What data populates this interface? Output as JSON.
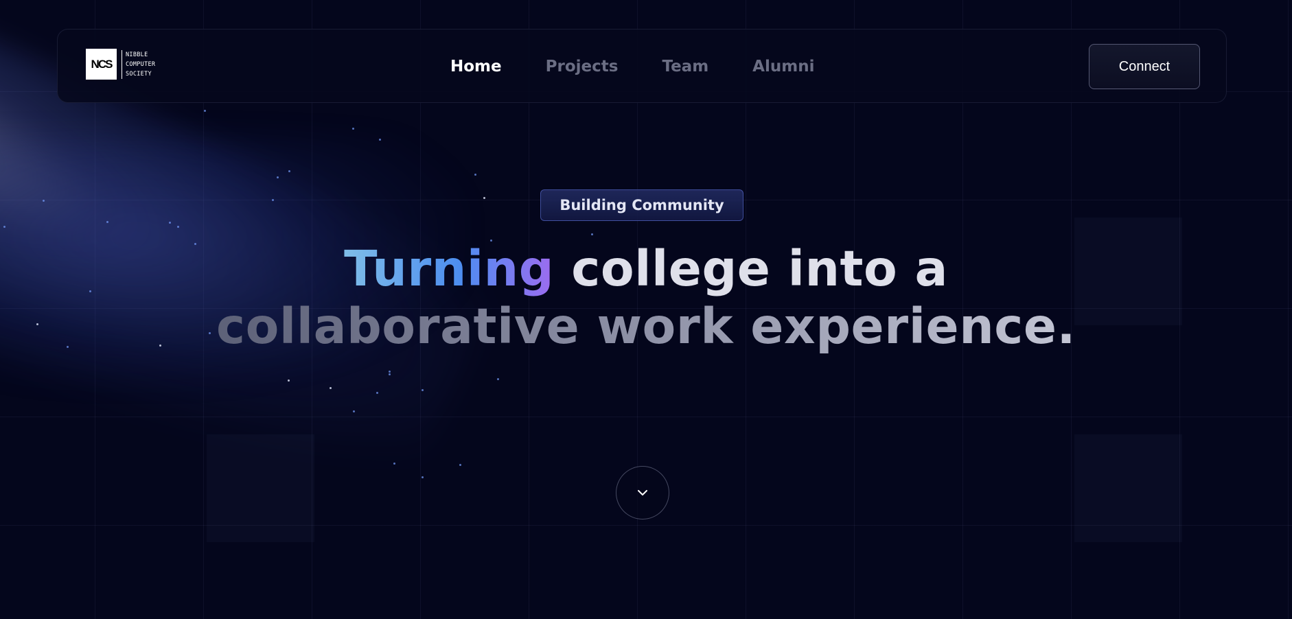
{
  "logo": {
    "mark": "NCS",
    "lines": [
      "NIBBLE",
      "COMPUTER",
      "SOCIETY"
    ]
  },
  "nav": {
    "links": [
      {
        "label": "Home",
        "active": true
      },
      {
        "label": "Projects",
        "active": false
      },
      {
        "label": "Team",
        "active": false
      },
      {
        "label": "Alumni",
        "active": false
      }
    ],
    "connect_label": "Connect"
  },
  "hero": {
    "badge": "Building Community",
    "headline_highlight": "Turning",
    "headline_line1_rest": " college into a",
    "headline_line2": "collaborative work experience."
  },
  "scroll": {
    "icon": "chevron-down-icon"
  },
  "colors": {
    "background": "#04061c",
    "accent_blue": "#4d8ef0",
    "accent_purple": "#9d6cf0",
    "text_primary": "#ffffff",
    "text_muted": "#6b6e84"
  }
}
